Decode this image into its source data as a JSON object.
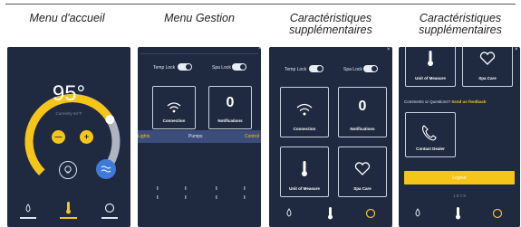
{
  "captions": {
    "p1": "Menu d'accueil",
    "p2": "Menu Gestion",
    "p3_line1": "Caractéristiques",
    "p3_line2": "supplémentaires",
    "p4_line1": "Caractéristiques",
    "p4_line2": "supplémentaires"
  },
  "home": {
    "temperature": "95°",
    "current": "Currently 94°F",
    "minus": "—",
    "plus": "+",
    "dial_level": 0.72,
    "accent": "#f5c518"
  },
  "gestion": {
    "temp_lock": "Temp Lock",
    "spa_lock": "Spa Lock",
    "connection": "Connection",
    "notifications_count": "0",
    "notifications": "Notifications",
    "tabs": [
      "Lights",
      "Pumps",
      "Control"
    ]
  },
  "features": {
    "temp_lock": "Temp Lock",
    "spa_lock": "Spa Lock",
    "connection": "Connection",
    "notifications_count": "0",
    "notifications": "Notifications",
    "unit": "Unit of Measure",
    "spa_care": "Spa Care"
  },
  "features2": {
    "unit": "Unit of Measure",
    "spa_care": "Spa Care",
    "comments_prefix": "Comments or Questions?",
    "comments_link": "Send us feedback",
    "contact": "Contact Dealer",
    "logout": "Logout",
    "version": "1.0.7.8"
  }
}
